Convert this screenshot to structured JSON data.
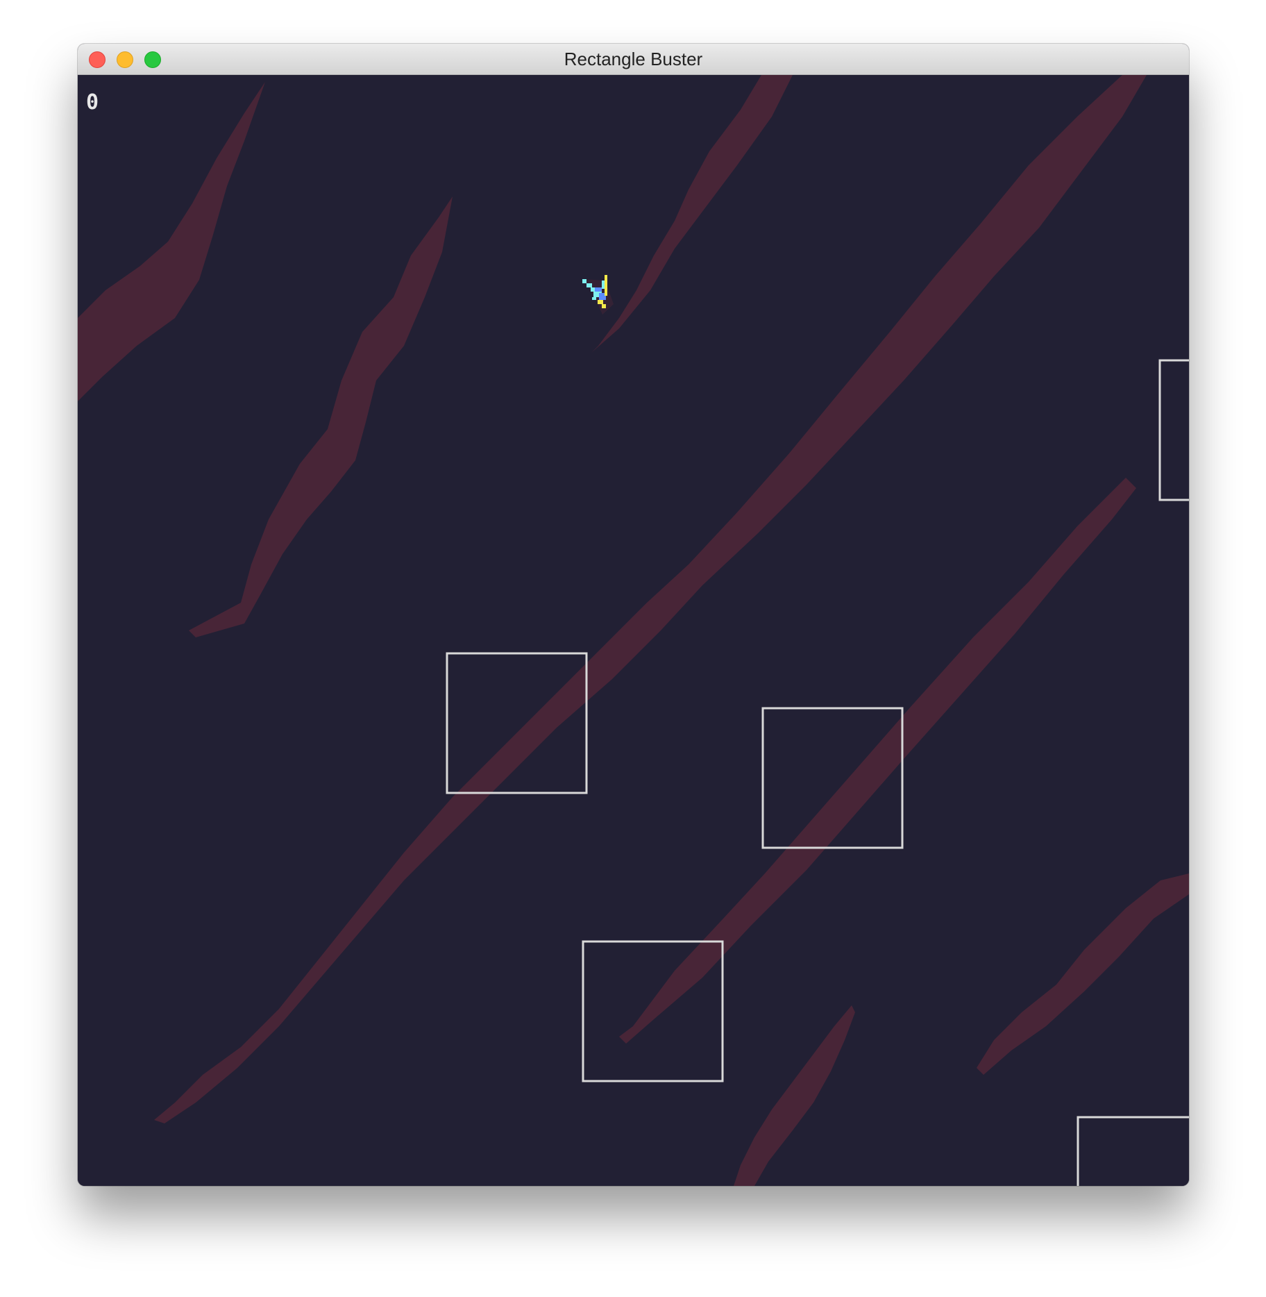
{
  "window": {
    "title": "Rectangle Buster"
  },
  "game": {
    "score": "0",
    "colors": {
      "background": "#222034",
      "streak": "#4b2638",
      "rectangle_outline": "#d9d9d9",
      "ship_cyan": "#7ef0f0",
      "ship_yellow": "#f3e94a",
      "ship_blue": "#5b8cff"
    },
    "sprites": {
      "player": "pixel-ship",
      "enemies": "outlined-rectangles",
      "background": "diagonal-streaks"
    },
    "enemy_count": 5
  }
}
